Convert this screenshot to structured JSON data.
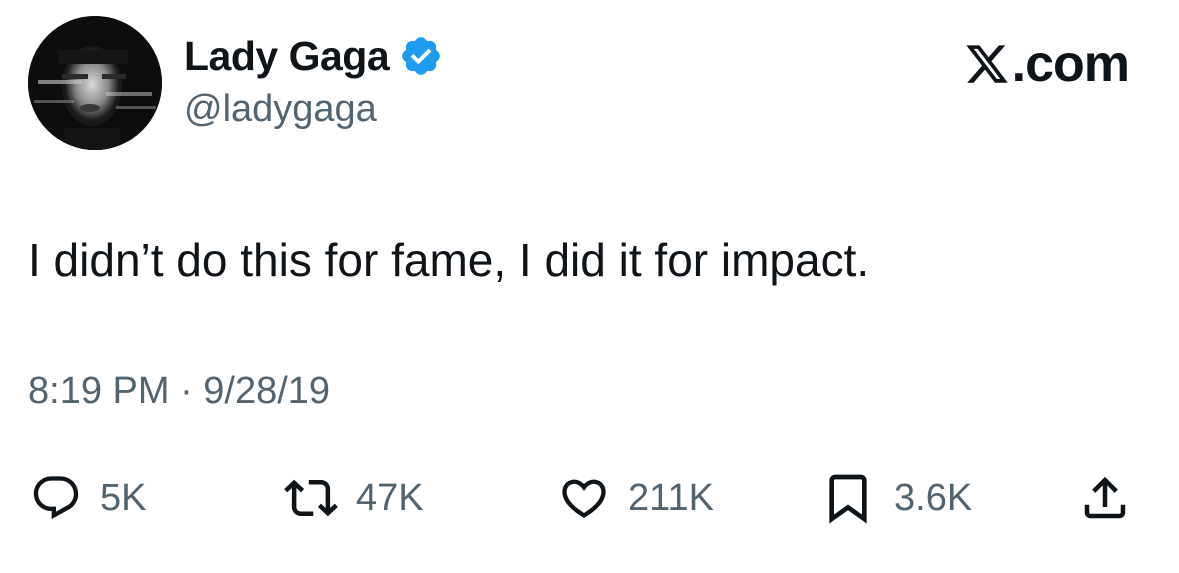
{
  "author": {
    "display_name": "Lady Gaga",
    "handle": "@ladygaga",
    "verified": true
  },
  "brand": {
    "text": ".com",
    "icon": "x-logo-icon"
  },
  "tweet": {
    "text": "I didn’t do this for fame, I did it for impact.",
    "timestamp": "8:19 PM · 9/28/19"
  },
  "actions": {
    "reply": {
      "icon": "reply-icon",
      "count": "5K"
    },
    "retweet": {
      "icon": "retweet-icon",
      "count": "47K"
    },
    "like": {
      "icon": "heart-icon",
      "count": "211K"
    },
    "bookmark": {
      "icon": "bookmark-icon",
      "count": "3.6K"
    },
    "share": {
      "icon": "share-icon"
    }
  },
  "colors": {
    "text_primary": "#0f1419",
    "text_secondary": "#536471",
    "verified_blue": "#1d9bf0",
    "background": "#ffffff"
  }
}
